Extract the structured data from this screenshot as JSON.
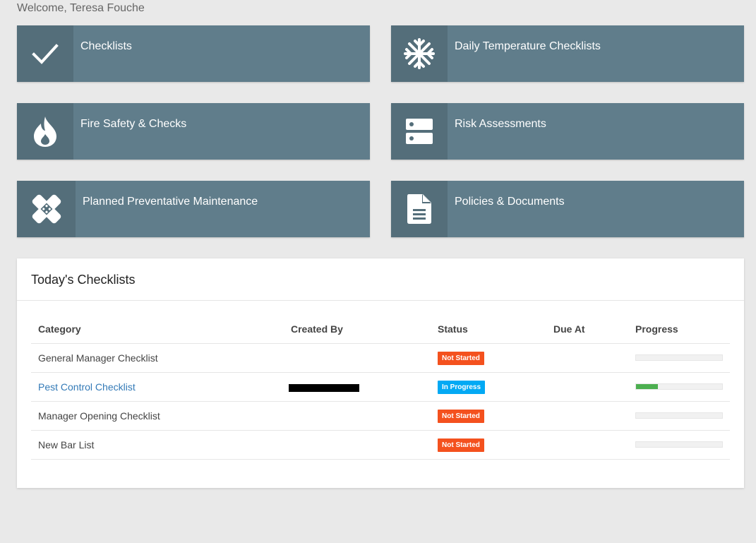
{
  "welcome": "Welcome, Teresa Fouche",
  "tiles": [
    {
      "label": "Checklists",
      "icon": "checkmark-icon"
    },
    {
      "label": "Daily Temperature Checklists",
      "icon": "snowflake-icon"
    },
    {
      "label": "Fire Safety & Checks",
      "icon": "fire-icon"
    },
    {
      "label": "Risk Assessments",
      "icon": "server-icon"
    },
    {
      "label": "Planned Preventative Maintenance",
      "icon": "bandage-icon"
    },
    {
      "label": "Policies & Documents",
      "icon": "document-icon"
    }
  ],
  "checklists": {
    "title": "Today's Checklists",
    "columns": [
      "Category",
      "Created By",
      "Status",
      "Due At",
      "Progress"
    ],
    "rows": [
      {
        "category": "General Manager Checklist",
        "created_by": "",
        "status": "Not Started",
        "status_color": "#f4511e",
        "due_at": "",
        "progress": 0
      },
      {
        "category": "Pest Control Checklist",
        "created_by": "[redacted]",
        "status": "In Progress",
        "status_color": "#03a9f4",
        "due_at": "",
        "progress": 0.25
      },
      {
        "category": "Manager Opening Checklist",
        "created_by": "",
        "status": "Not Started",
        "status_color": "#f4511e",
        "due_at": "",
        "progress": 0
      },
      {
        "category": "New Bar List",
        "created_by": "",
        "status": "Not Started",
        "status_color": "#f4511e",
        "due_at": "",
        "progress": 0
      }
    ]
  },
  "colors": {
    "tile": "#607d8b",
    "tile_icon_bg": "#546e7a",
    "not_started": "#f4511e",
    "in_progress": "#03a9f4",
    "progress_fill": "#4caf50"
  }
}
